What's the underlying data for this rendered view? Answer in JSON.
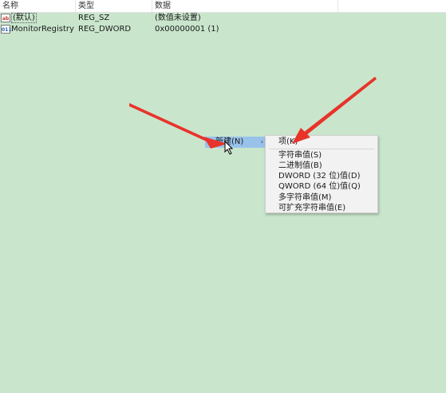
{
  "columns": {
    "name": "名称",
    "type": "类型",
    "data": "数据"
  },
  "values": [
    {
      "icon": "string-value-icon",
      "icon_text": "ab",
      "name": "(默认)",
      "type": "REG_SZ",
      "data": "(数值未设置)"
    },
    {
      "icon": "binary-value-icon",
      "icon_text": "011",
      "name": "MonitorRegistry",
      "type": "REG_DWORD",
      "data": "0x00000001 (1)"
    }
  ],
  "context_menu": {
    "new_label": "新建(N)",
    "arrow": "›"
  },
  "submenu": {
    "items": [
      "项(K)",
      "字符串值(S)",
      "二进制值(B)",
      "DWORD (32 位)值(D)",
      "QWORD (64 位)值(Q)",
      "多字符串值(M)",
      "可扩充字符串值(E)"
    ]
  },
  "colors": {
    "background": "#c9e6cc",
    "highlight": "#99c2ea",
    "arrow": "#e8332a"
  }
}
